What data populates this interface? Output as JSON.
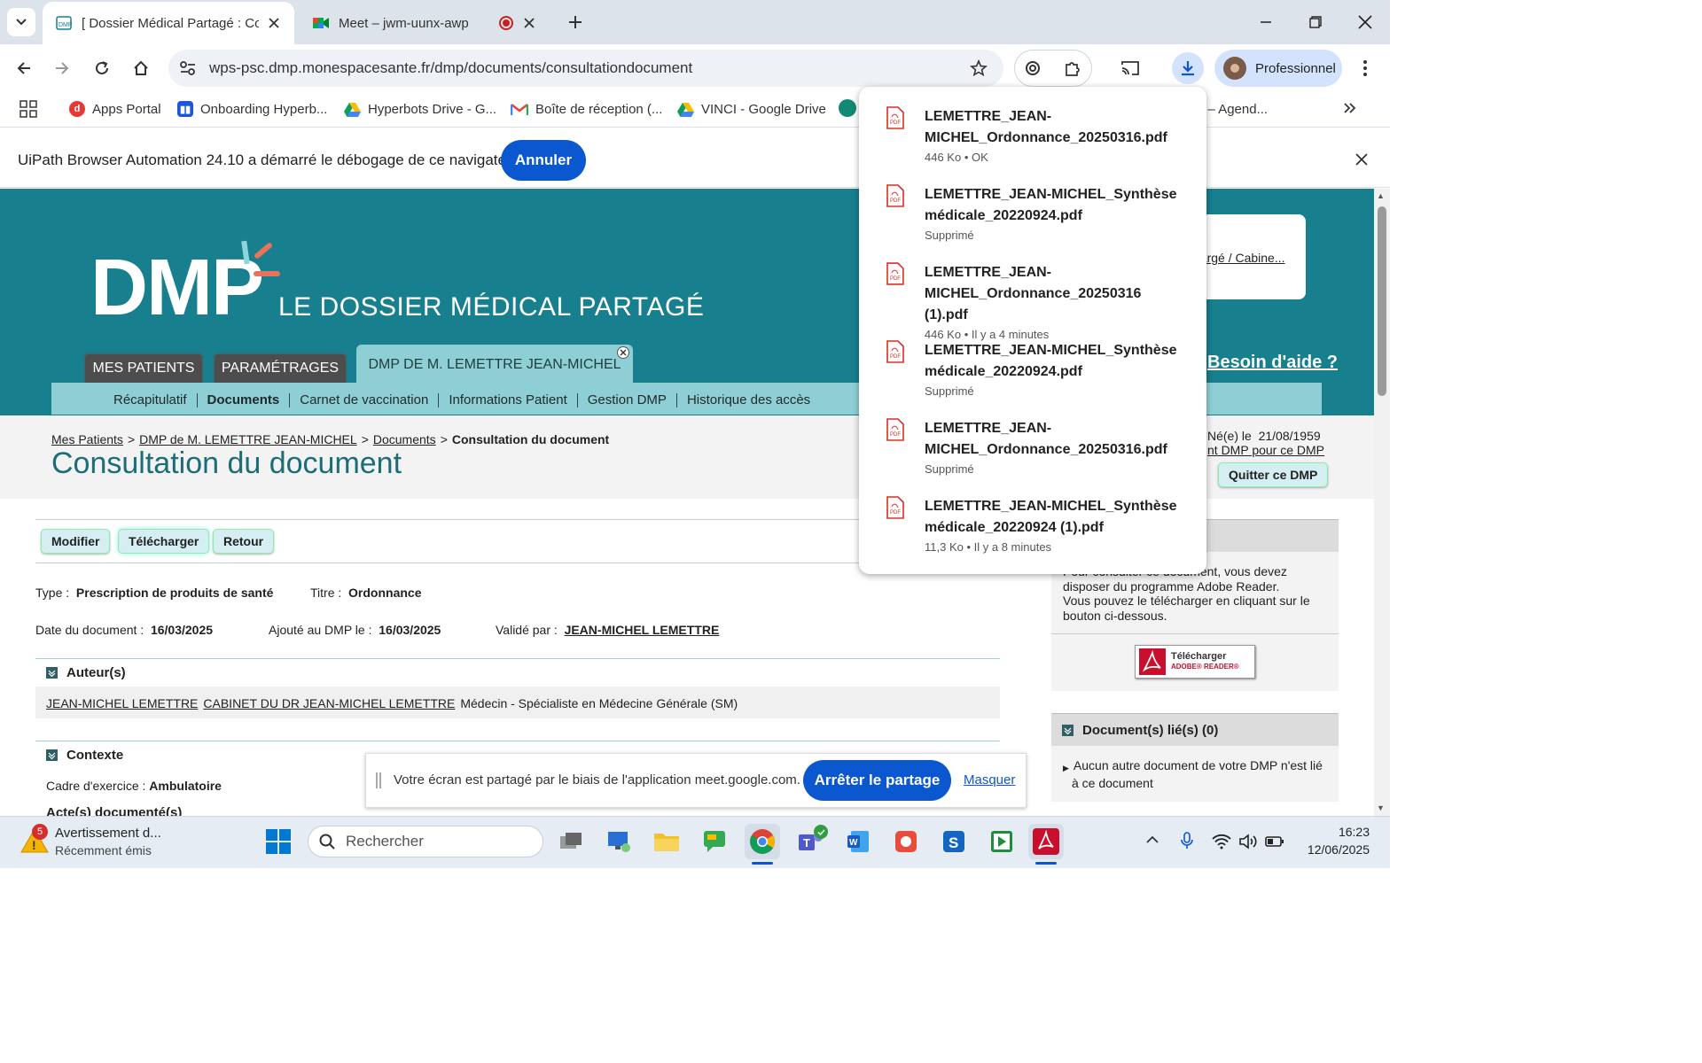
{
  "browser": {
    "tabs": [
      {
        "title": "[ Dossier Médical Partagé : Con",
        "active": true
      },
      {
        "title": "Meet – jwm-uunx-awp",
        "active": false
      }
    ],
    "url": "wps-psc.dmp.monespacesante.fr/dmp/documents/consultationdocument",
    "profile": "Professionnel",
    "bookmarks": [
      "Apps Portal",
      "Onboarding Hyperb...",
      "Hyperbots Drive - G...",
      "Boîte de réception (...",
      "VINCI - Google Drive",
      "n – Agend..."
    ]
  },
  "infobar": {
    "message": "UiPath Browser Automation 24.10 a démarré le débogage de ce navigateur",
    "button": "Annuler"
  },
  "dmp": {
    "logo": "DMP",
    "tagline": "LE DOSSIER MÉDICAL PARTAGÉ",
    "tabs": [
      "MES PATIENTS",
      "PARAMÉTRAGES",
      "DMP DE M. LEMETTRE JEAN-MICHEL"
    ],
    "subnav": [
      "Récapitulatif",
      "Documents",
      "Carnet de vaccination",
      "Informations Patient",
      "Gestion DMP",
      "Historique des accès"
    ],
    "help": "Besoin d'aide ?",
    "account_box": "hargé / Cabine...",
    "breadcrumb": {
      "a": "Mes Patients",
      "sep": ">",
      "b": "DMP de M. LEMETTRE JEAN-MICHEL",
      "c": "Documents",
      "d": "Consultation du document"
    },
    "page_title": "Consultation du document",
    "birth_label": "Né(e) le",
    "birth_date": "21/08/1959",
    "dmp_link": "nt DMP pour ce DMP",
    "quit_button": "Quitter ce DMP",
    "actions": [
      "Modifier",
      "Télécharger",
      "Retour"
    ],
    "type_label": "Type :",
    "type_value": "Prescription de produits de santé",
    "titre_label": "Titre :",
    "titre_value": "Ordonnance",
    "date_label": "Date du document :",
    "date_value": "16/03/2025",
    "added_label": "Ajouté au DMP le :",
    "added_value": "16/03/2025",
    "validated_label": "Validé par :",
    "validated_value": "JEAN-MICHEL LEMETTRE",
    "authors_title": "Auteur(s)",
    "author_name": "JEAN-MICHEL LEMETTRE",
    "author_org": "CABINET DU DR JEAN-MICHEL LEMETTRE",
    "author_role": "Médecin - Spécialiste en Médecine Générale (SM)",
    "context_title": "Contexte",
    "cadre_label": "Cadre d'exercice :",
    "cadre_value": "Ambulatoire",
    "actes_title": "Acte(s) documenté(s)",
    "adobe_text": [
      "Pour consulter ce document, vous devez",
      "disposer du programme Adobe Reader.",
      "Vous pouvez le télécharger en cliquant sur le",
      "bouton ci-dessous."
    ],
    "adobe_button": [
      "Télécharger",
      "ADOBE® READER®"
    ],
    "linked_title": "Document(s) lié(s) (0)",
    "linked_text": [
      "Aucun autre document de votre DMP n'est lié",
      "à ce document"
    ]
  },
  "downloads": [
    {
      "name": [
        "LEMETTRE_JEAN-",
        "MICHEL_Ordonnance_20250316.pdf"
      ],
      "meta": "446 Ko • OK"
    },
    {
      "name": [
        "LEMETTRE_JEAN-MICHEL_Synthèse",
        "médicale_20220924.pdf"
      ],
      "meta": "Supprimé"
    },
    {
      "name": [
        "LEMETTRE_JEAN-",
        "MICHEL_Ordonnance_20250316 (1).pdf"
      ],
      "meta": "446 Ko • Il y a 4 minutes"
    },
    {
      "name": [
        "LEMETTRE_JEAN-MICHEL_Synthèse",
        "médicale_20220924.pdf"
      ],
      "meta": "Supprimé"
    },
    {
      "name": [
        "LEMETTRE_JEAN-",
        "MICHEL_Ordonnance_20250316.pdf"
      ],
      "meta": "Supprimé"
    },
    {
      "name": [
        "LEMETTRE_JEAN-MICHEL_Synthèse",
        "médicale_20220924 (1).pdf"
      ],
      "meta": "11,3 Ko • Il y a 8 minutes"
    }
  ],
  "screenshare": {
    "message": "Votre écran est partagé par le biais de l'application meet.google.com.",
    "stop": "Arrêter le partage",
    "hide": "Masquer"
  },
  "taskbar": {
    "notif_count": "5",
    "notif_title": "Avertissement d...",
    "notif_sub": "Récemment émis",
    "search": "Rechercher",
    "time": "16:23",
    "date": "12/06/2025"
  },
  "colors": {
    "teal": "#177f8e",
    "accent": "#0b57d0",
    "orange": "#e8735a"
  }
}
